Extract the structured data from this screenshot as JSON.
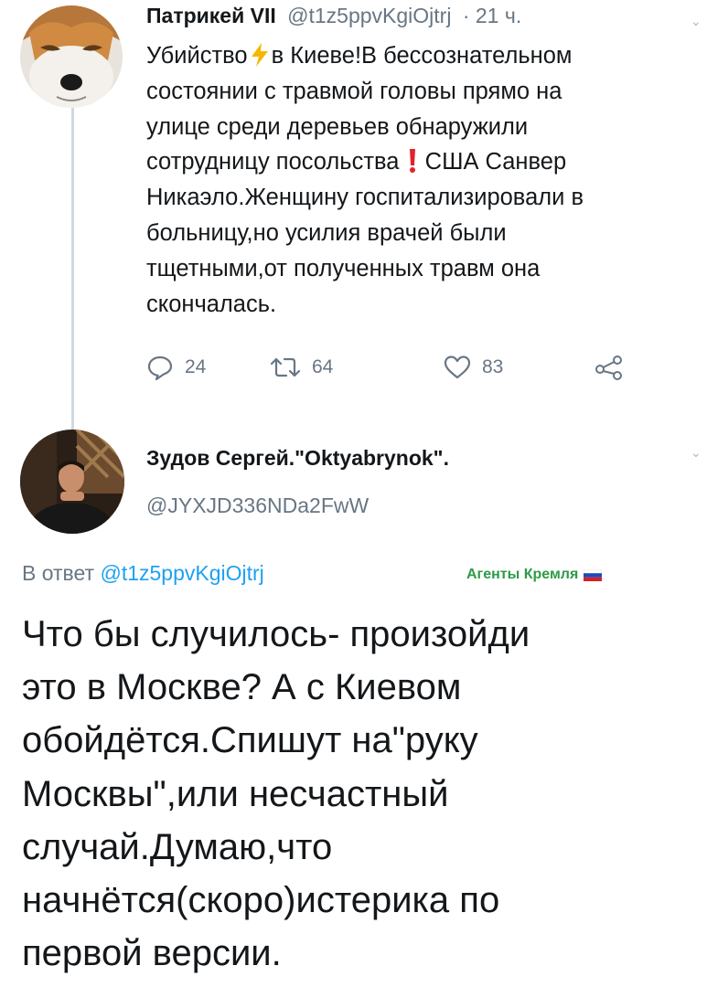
{
  "parent_tweet": {
    "author_name": "Патрикей VII",
    "handle": "@t1z5ppvKgiOjtrj",
    "time": "· 21 ч.",
    "avatar_icon": "fox-avatar",
    "text_lines": [
      "Убийство",
      "в Киеве!В бессознательном",
      "состоянии с травмой головы прямо на",
      "улице среди деревьев обнаружили",
      "сотрудницу посольства",
      "США Санвер",
      "Никаэло.Женщину госпитализировали в",
      "больницу,но усилия врачей были",
      "тщетными,от полученных травм она",
      "скончалась."
    ],
    "emoji_icons": [
      "high-voltage-icon",
      "exclamation-mark-icon"
    ],
    "actions": {
      "reply_count": "24",
      "retweet_count": "64",
      "like_count": "83"
    }
  },
  "reply_tweet": {
    "author_name": "Зудов Сергей.\"Oktyabrynok\".",
    "handle": "@JYXJD336NDa2FwW",
    "avatar_icon": "user-photo-avatar",
    "reply_prefix": "В ответ",
    "reply_handle": "@t1z5ppvKgiOjtrj",
    "overlay_label": "Агенты Кремля",
    "overlay_flag_icon": "russian-flag-icon",
    "text_lines": [
      "Что бы случилось- произойди",
      "это в Москве? А с Киевом",
      "обойдётся.Спишут на\"руку",
      "Москвы\",или несчастный",
      "случай.Думаю,что",
      "начнётся(скоро)истерика по",
      "первой версии."
    ]
  },
  "colors": {
    "text": "#14171a",
    "secondary_text": "#687684",
    "link": "#1da1f2",
    "thread_line": "#cfd9de",
    "overlay_label": "#2d9b46"
  }
}
